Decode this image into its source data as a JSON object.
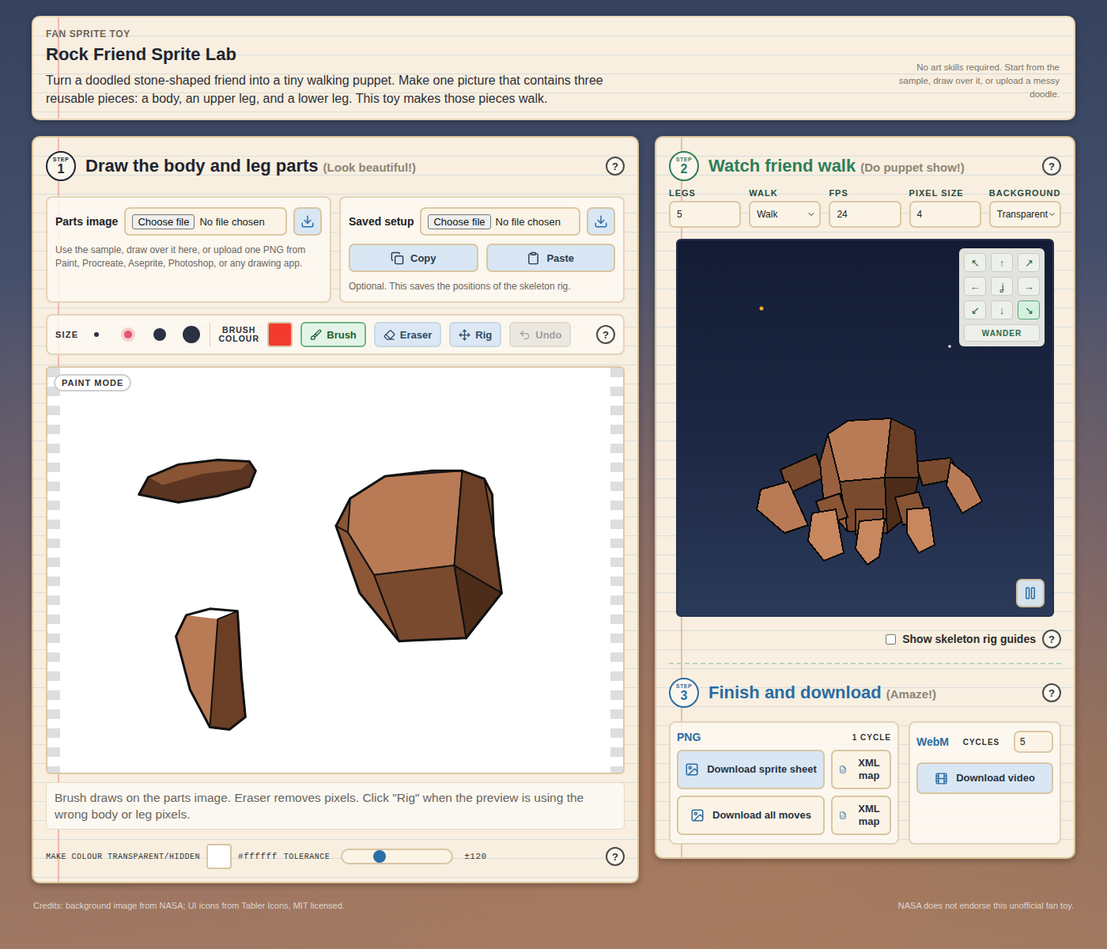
{
  "header": {
    "eyebrow": "FAN SPRITE TOY",
    "title": "Rock Friend Sprite Lab",
    "intro": "Turn a doodled stone-shaped friend into a tiny walking puppet. Make one picture that contains three reusable pieces: a body, an upper leg, and a lower leg. This toy makes those pieces walk.",
    "note": "No art skills required. Start from the sample, draw over it, or upload a messy doodle."
  },
  "help": "?",
  "step1": {
    "badge": {
      "label": "STEP",
      "number": "1"
    },
    "title": "Draw the body and leg parts",
    "subtitle": "(Look beautiful!)",
    "parts_image": {
      "label": "Parts image",
      "file_button": "Choose file",
      "file_status": "No file chosen",
      "description": "Use the sample, draw over it here, or upload one PNG from Paint, Procreate, Aseprite, Photoshop, or any drawing app."
    },
    "saved_setup": {
      "label": "Saved setup",
      "file_button": "Choose file",
      "file_status": "No file chosen",
      "buttons": [
        {
          "label": "Copy"
        },
        {
          "label": "Paste"
        }
      ],
      "description": "Optional. This saves the positions of the skeleton rig."
    },
    "toolbar": {
      "size_label": "SIZE",
      "sizes": [
        {
          "selected": false
        },
        {
          "selected": true
        },
        {
          "selected": false
        },
        {
          "selected": false
        }
      ],
      "colour_label": "BRUSH COLOUR",
      "brush_color": "#f23b2c",
      "tools": [
        {
          "label": "Brush",
          "selected": true,
          "disabled": false
        },
        {
          "label": "Eraser",
          "selected": false,
          "disabled": false
        },
        {
          "label": "Rig",
          "selected": false,
          "disabled": false
        },
        {
          "label": "Undo",
          "selected": false,
          "disabled": true
        }
      ]
    },
    "canvas": {
      "mode_badge": "PAINT MODE"
    },
    "hint": "Brush draws on the parts image. Eraser removes pixels. Click \"Rig\" when the preview is using the wrong body or leg pixels.",
    "transparency": {
      "label": "MAKE COLOUR TRANSPARENT/HIDDEN",
      "colour": "#ffffff",
      "tolerance_label": "TOLERANCE",
      "level": 0.34,
      "reading": "±120"
    }
  },
  "step2": {
    "badge": {
      "label": "STEP",
      "number": "2"
    },
    "title": "Watch friend walk",
    "subtitle": "(Do puppet show!)",
    "controls": [
      {
        "label": "LEGS",
        "value": "5",
        "kind": "input"
      },
      {
        "label": "WALK",
        "value": "Walk",
        "kind": "select"
      },
      {
        "label": "FPS",
        "value": "24",
        "kind": "input"
      },
      {
        "label": "PIXEL SIZE",
        "value": "4",
        "kind": "input"
      },
      {
        "label": "BACKGROUND",
        "value": "Transparent",
        "kind": "select"
      }
    ],
    "directions": [
      {
        "glyph": "↖",
        "selected": false
      },
      {
        "glyph": "↑",
        "selected": false
      },
      {
        "glyph": "↗",
        "selected": false
      },
      {
        "glyph": "←",
        "selected": false
      },
      {
        "glyph": "ʝ",
        "selected": false
      },
      {
        "glyph": "→",
        "selected": false
      },
      {
        "glyph": "↙",
        "selected": false
      },
      {
        "glyph": "↓",
        "selected": false
      },
      {
        "glyph": "↘",
        "selected": true
      }
    ],
    "wander": "WANDER",
    "playing": true,
    "skeleton_guides": {
      "label": "Show skeleton rig guides",
      "checked": false
    }
  },
  "step3": {
    "badge": {
      "label": "STEP",
      "number": "3"
    },
    "title": "Finish and download",
    "subtitle": "(Amaze!)",
    "png": {
      "label": "PNG",
      "cycles": "1 CYCLE",
      "rows": [
        {
          "main": "Download sprite sheet",
          "map": "XML map",
          "primary": true
        },
        {
          "main": "Download all moves",
          "map": "XML map",
          "primary": false
        }
      ]
    },
    "webm": {
      "label": "WebM",
      "cycles_label": "CYCLES",
      "cycles": "5",
      "button": "Download video"
    }
  },
  "footer": {
    "credits": "Credits: background image from NASA; UI icons from Tabler Icons, MIT licensed.",
    "disclaimer": "NASA does not endorse this unofficial fan toy."
  }
}
